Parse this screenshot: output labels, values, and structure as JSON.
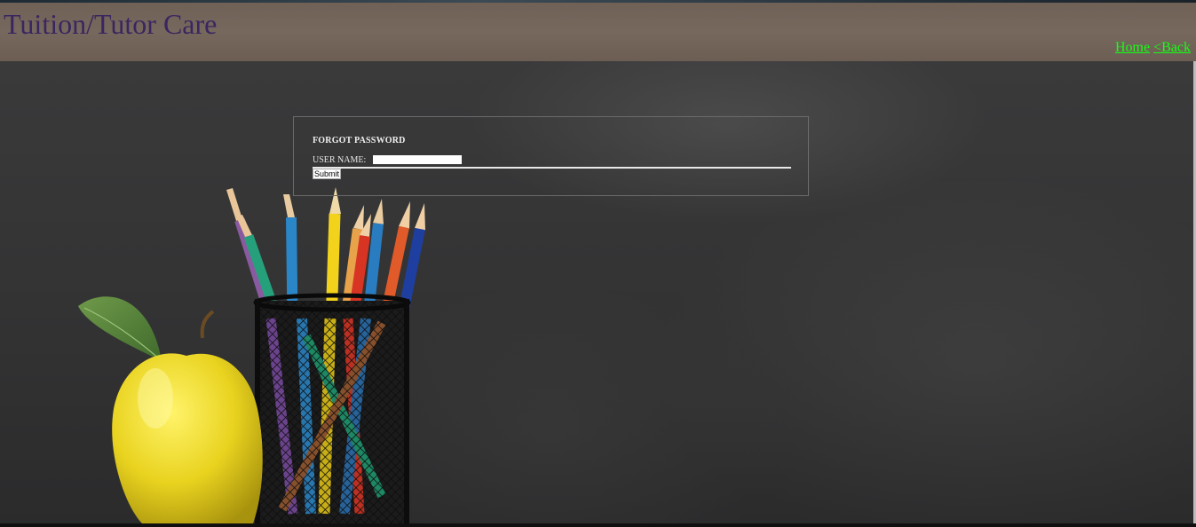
{
  "header": {
    "title": "Tuition/Tutor Care",
    "nav": {
      "home_label": "Home",
      "back_label": "<Back"
    }
  },
  "form": {
    "title": "FORGOT PASSWORD",
    "username_label": "USER NAME:",
    "username_value": "",
    "submit_label": "Submit"
  },
  "colors": {
    "title": "#3a2660",
    "nav_link": "#14ff14",
    "header_bg": "#76685d",
    "chalkboard_bg": "#333334"
  },
  "icons": {
    "apple": "apple-icon",
    "pencil_cup": "pencil-cup-icon"
  }
}
